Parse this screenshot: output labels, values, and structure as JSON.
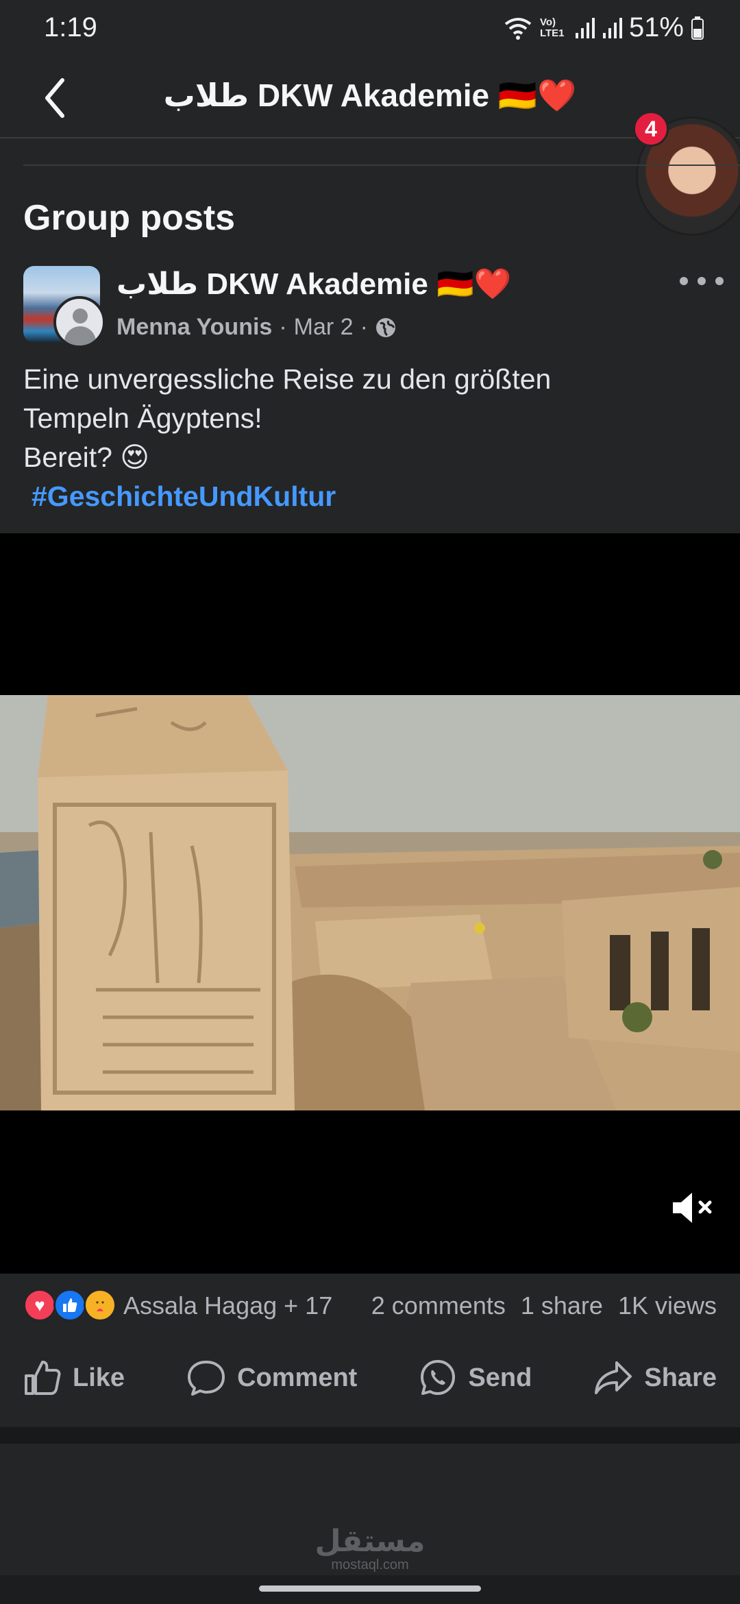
{
  "status_bar": {
    "time": "1:19",
    "network_label": "Vo) LTE1",
    "battery": "51%"
  },
  "header": {
    "title": "طلاب DKW Akademie 🇩🇪❤️"
  },
  "chat_head": {
    "badge_count": "4"
  },
  "section": {
    "title": "Group posts"
  },
  "post": {
    "group_name": "طلاب DKW Akademie 🇩🇪❤️",
    "author": "Menna Younis",
    "separator": "·",
    "date": "Mar 2",
    "visibility_icon": "globe-icon",
    "text_line1": "Eine unvergessliche Reise zu den größten",
    "text_line2": "Tempeln Ägyptens!",
    "text_line3": "Bereit? 😍",
    "hashtag": "#GeschichteUndKultur"
  },
  "video": {
    "muted": true
  },
  "reactions": {
    "icons": [
      "love",
      "like",
      "care"
    ],
    "names": "Assala Hagag + 17",
    "comments": "2 comments",
    "shares": "1 share",
    "views": "1K views"
  },
  "actions": {
    "like": "Like",
    "comment": "Comment",
    "send": "Send",
    "share": "Share"
  },
  "watermark": {
    "arabic": "مستقل",
    "latin": "mostaql.com"
  },
  "colors": {
    "background": "#242526",
    "hashtag": "#4599ff",
    "badge": "#e41e3f",
    "secondary_text": "#b0b3b8"
  }
}
